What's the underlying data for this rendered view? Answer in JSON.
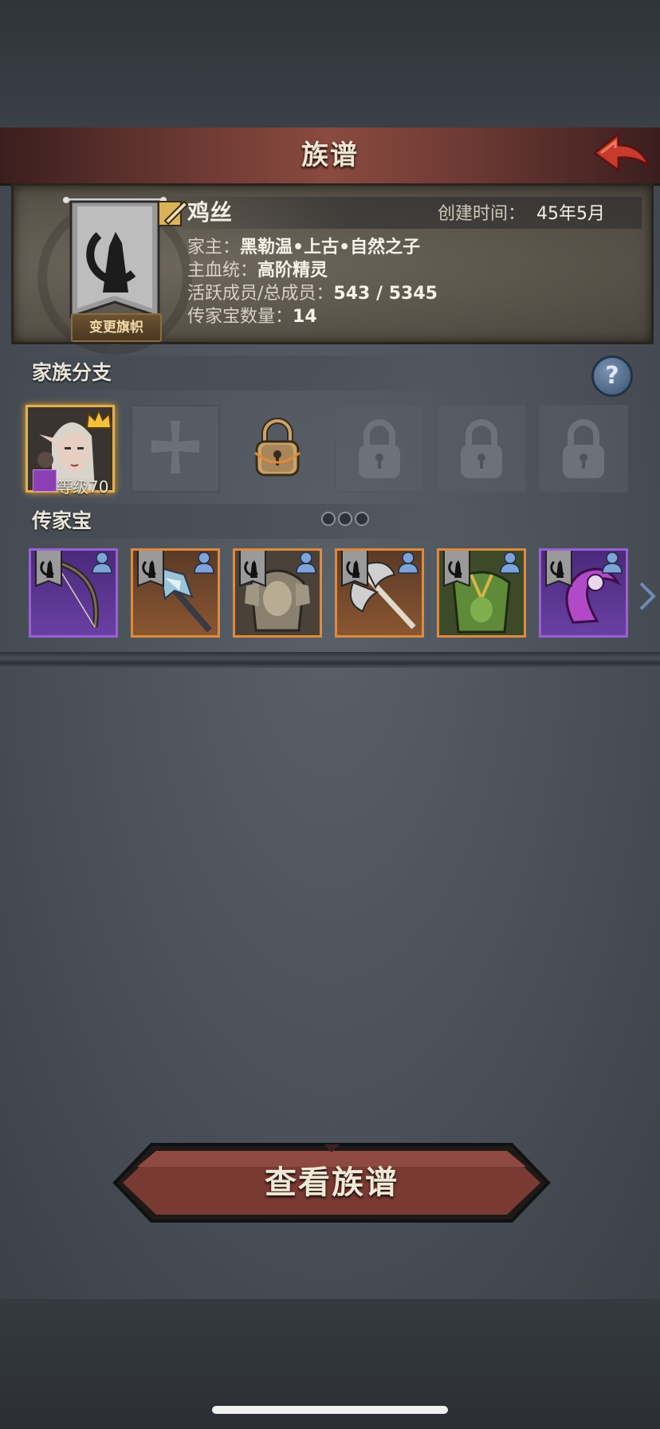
{
  "title": "族谱",
  "info": {
    "banner_button": "变更旗帜",
    "clan_name": "鸡丝",
    "created_label": "创建时间：",
    "created_value": "45年5月",
    "rows": [
      {
        "label": "家主：",
        "value": "黑勒温•上古•自然之子"
      },
      {
        "label": "主血统：",
        "value": "高阶精灵"
      },
      {
        "label": "活跃成员/总成员：",
        "value": "543 / 5345"
      },
      {
        "label": "传家宝数量：",
        "value": "14"
      }
    ]
  },
  "branch": {
    "title": "家族分支",
    "help_label": "?",
    "member": {
      "level_label": "等级70"
    }
  },
  "heirloom": {
    "title": "传家宝",
    "items": [
      {
        "rarity": "purple",
        "icon": "bow-icon"
      },
      {
        "rarity": "orange",
        "icon": "crystal-staff-icon"
      },
      {
        "rarity": "orange",
        "icon": "armor-icon"
      },
      {
        "rarity": "orange",
        "icon": "double-axe-icon"
      },
      {
        "rarity": "orange",
        "icon": "green-armor-icon"
      },
      {
        "rarity": "purple",
        "icon": "purple-scythe-icon"
      }
    ]
  },
  "view_button": "查看族谱",
  "colors": {
    "accent_gold": "#e6b04a",
    "rarity_purple": "#9b5fd6",
    "rarity_orange": "#e08a3a",
    "button_red": "#7a3a34"
  }
}
